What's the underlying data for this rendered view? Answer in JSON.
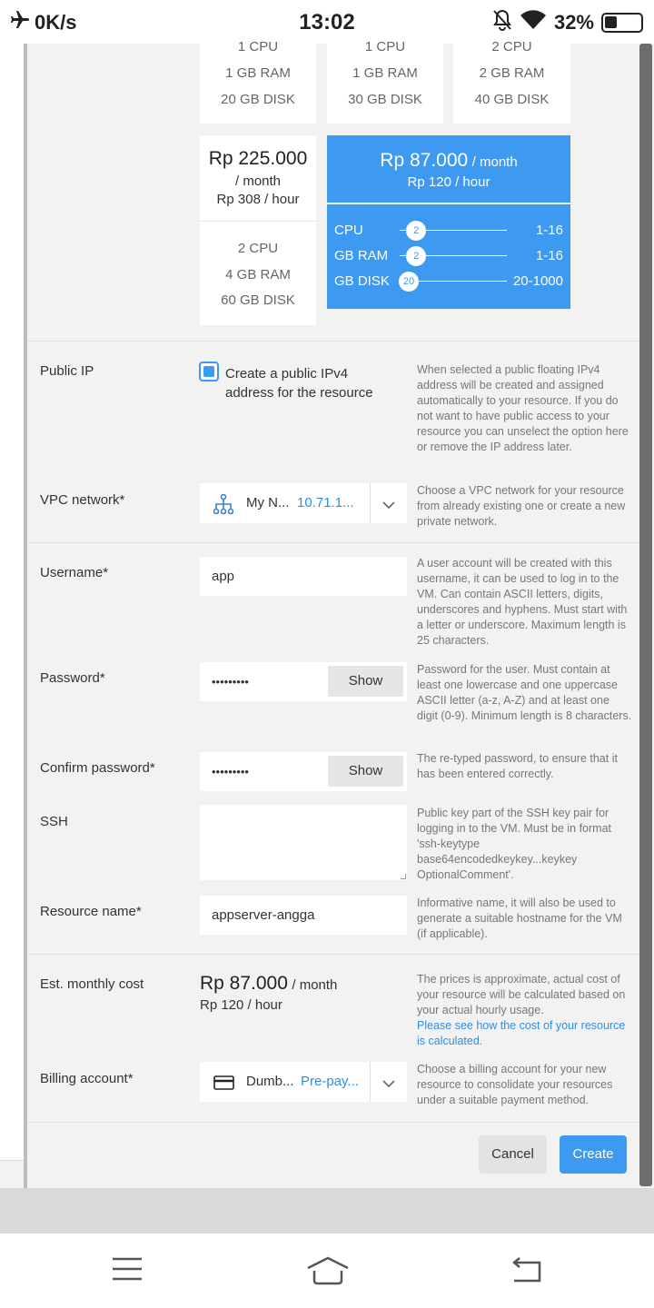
{
  "statusbar": {
    "net_speed": "0K/s",
    "time": "13:02",
    "battery": "32%"
  },
  "plans_top": [
    {
      "cpu": "1 CPU",
      "ram": "1 GB RAM",
      "disk": "20 GB DISK"
    },
    {
      "cpu": "1 CPU",
      "ram": "1 GB RAM",
      "disk": "30 GB DISK"
    },
    {
      "cpu": "2 CPU",
      "ram": "2 GB RAM",
      "disk": "40 GB DISK"
    }
  ],
  "plan_mid": {
    "price": "Rp 225.000",
    "per_month": "/ month",
    "hourly": "Rp 308 / hour",
    "cpu": "2 CPU",
    "ram": "4 GB RAM",
    "disk": "60 GB DISK"
  },
  "custom_plan": {
    "price": "Rp 87.000",
    "per_month": "/ month",
    "hourly": "Rp 120 / hour",
    "sliders": [
      {
        "label": "CPU",
        "value": "2",
        "range": "1-16",
        "fraction": 0.07
      },
      {
        "label": "GB RAM",
        "value": "2",
        "range": "1-16",
        "fraction": 0.07
      },
      {
        "label": "GB DISK",
        "value": "20",
        "range": "20-1000",
        "fraction": 0.0
      }
    ]
  },
  "public_ip": {
    "label": "Public IP",
    "checkbox_label_1": "Create a public IPv4",
    "checkbox_label_2": "address for the resource",
    "checked": true,
    "help": "When selected a public floating IPv4 address will be created and assigned automatically to your resource. If you do not want to have public access to your resource you can unselect the option here or remove the IP address later."
  },
  "vpc": {
    "label": "VPC network*",
    "name": "My N...",
    "subnet": "10.71.1...",
    "help": "Choose a VPC network for your resource from already existing one or create a new private network."
  },
  "username": {
    "label": "Username*",
    "value": "app",
    "help": "A user account will be created with this username, it can be used to log in to the VM. Can contain ASCII letters, digits, underscores and hyphens. Must start with a letter or underscore. Maximum length is 25 characters."
  },
  "password": {
    "label": "Password*",
    "value": "•••••••••",
    "show": "Show",
    "help": "Password for the user. Must contain at least one lowercase and one uppercase ASCII letter (a-z, A-Z) and at least one digit (0-9). Minimum length is 8 characters."
  },
  "confirm_password": {
    "label": "Confirm password*",
    "value": "•••••••••",
    "show": "Show",
    "help": "The re-typed password, to ensure that it has been entered correctly."
  },
  "ssh": {
    "label": "SSH",
    "value": "",
    "help": "Public key part of the SSH key pair for logging in to the VM. Must be in format 'ssh-keytype base64encodedkeykey...keykey OptionalComment'."
  },
  "resource_name": {
    "label": "Resource name*",
    "value": "appserver-angga",
    "help": "Informative name, it will also be used to generate a suitable hostname for the VM (if applicable)."
  },
  "cost": {
    "label": "Est. monthly cost",
    "price": "Rp 87.000",
    "per_month": "/ month",
    "hourly": "Rp 120 / hour",
    "help": "The prices is approximate, actual cost of your resource will be calculated based on your actual hourly usage.",
    "help_link": "Please see how the cost of your resource is calculated."
  },
  "billing": {
    "label": "Billing account*",
    "name": "Dumb...",
    "type": "Pre-pay...",
    "help": "Choose a billing account for your new resource to consolidate your resources under a suitable payment method."
  },
  "actions": {
    "cancel": "Cancel",
    "create": "Create"
  },
  "colors": {
    "accent": "#3d9af0",
    "page_bg": "#f2f2f2"
  },
  "icons": [
    "airplane-icon",
    "bell-off-icon",
    "wifi-icon",
    "battery-icon",
    "network-tree-icon",
    "chevron-down-icon",
    "credit-card-icon",
    "menu-icon",
    "home-icon",
    "back-icon"
  ]
}
